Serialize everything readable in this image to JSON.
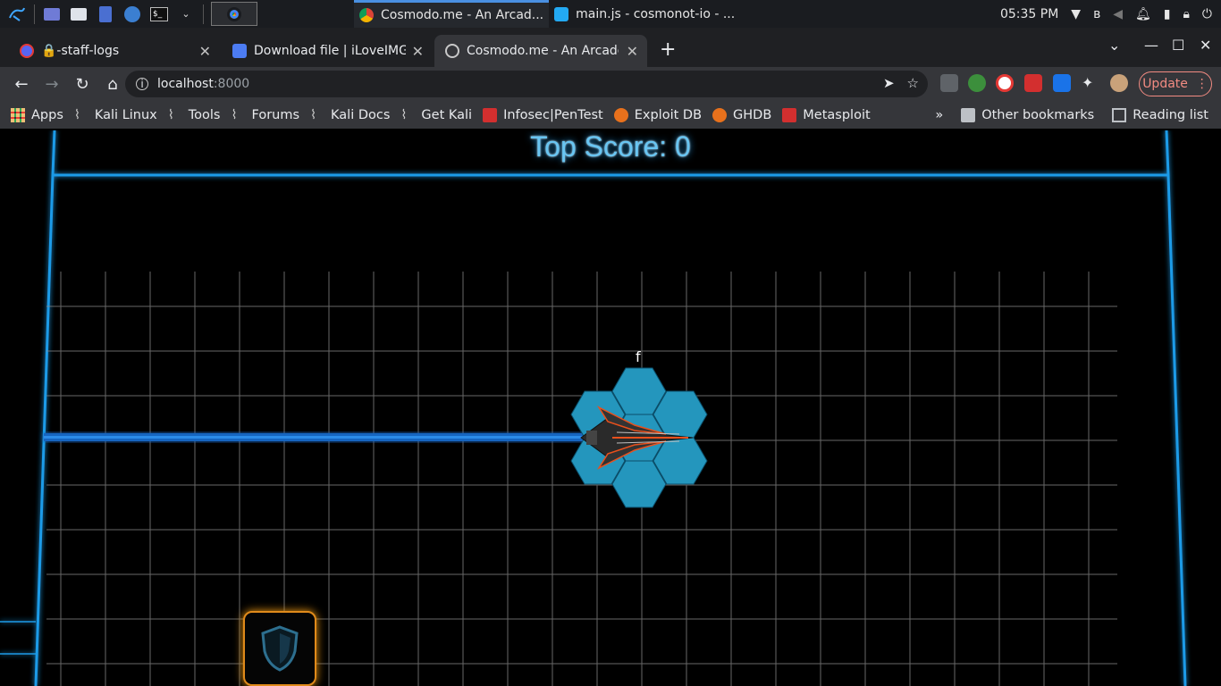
{
  "taskbar": {
    "windows": [
      {
        "label": "Cosmodo.me - An Arcad...",
        "icon": "chrome-icon"
      },
      {
        "label": "main.js - cosmonot-io - ...",
        "icon": "vscode-icon"
      }
    ],
    "clock": "05:35 PM"
  },
  "browser": {
    "tabs": [
      {
        "title": "🔒-staff-logs",
        "active": false
      },
      {
        "title": "Download file | iLoveIMG",
        "active": false
      },
      {
        "title": "Cosmodo.me - An Arcade",
        "active": true
      }
    ],
    "address": {
      "host": "localhost",
      "port": ":8000"
    },
    "update_label": "Update"
  },
  "bookmarks": {
    "items": [
      "Apps",
      "Kali Linux",
      "Tools",
      "Forums",
      "Kali Docs",
      "Get Kali",
      "Infosec|PenTest",
      "Exploit DB",
      "GHDB",
      "Metasploit"
    ],
    "overflow": "»",
    "other": "Other bookmarks",
    "reading_list": "Reading list"
  },
  "game": {
    "top_score_label": "Top Score: 0",
    "player_name": "f",
    "colors": {
      "neon": "#1e9be8",
      "hex": "#2496bd",
      "shield_border": "#e08a1a"
    }
  }
}
